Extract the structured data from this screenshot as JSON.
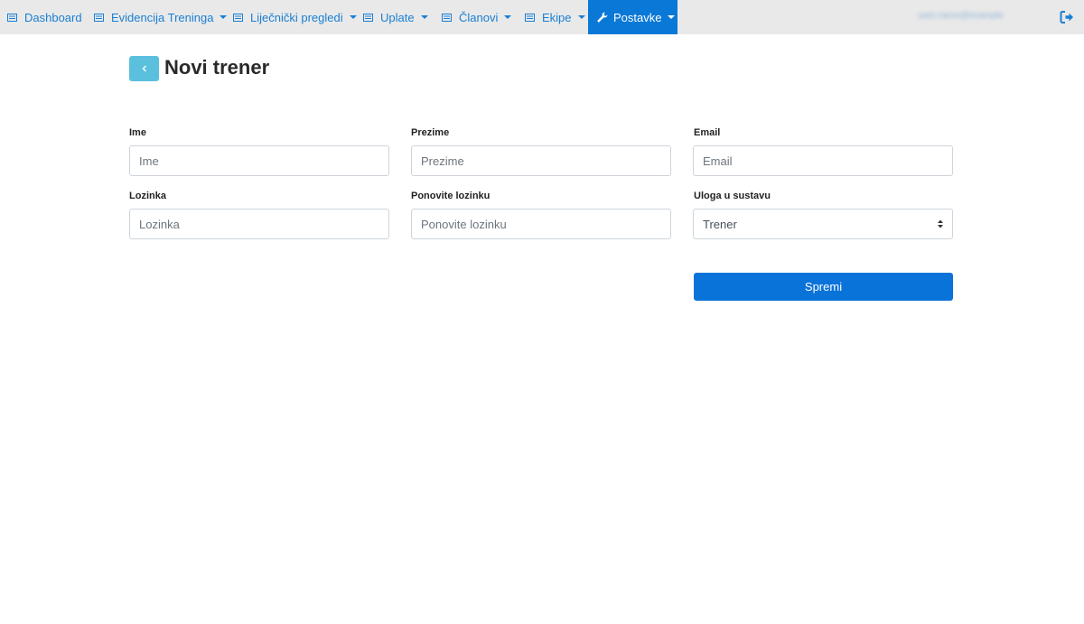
{
  "nav": {
    "items": [
      {
        "label": "Dashboard",
        "icon": "list-icon",
        "caret": false
      },
      {
        "label": "Evidencija Treninga",
        "icon": "list-icon",
        "caret": true
      },
      {
        "label": "Liječnički pregledi",
        "icon": "list-icon",
        "caret": true
      },
      {
        "label": "Uplate",
        "icon": "list-icon",
        "caret": true
      },
      {
        "label": "Članovi",
        "icon": "list-icon",
        "caret": true
      },
      {
        "label": "Ekipe",
        "icon": "list-icon",
        "caret": true
      },
      {
        "label": "Postavke",
        "icon": "wrench-icon",
        "caret": true,
        "active": true
      }
    ],
    "user_name": "user.name@example",
    "logout_icon": "sign-out-icon",
    "colors": {
      "bar": "#e9e9e9",
      "link": "#1a7fd4",
      "active": "#0a78d6"
    }
  },
  "header": {
    "back_icon": "chevron-left-icon",
    "title": "Novi trener"
  },
  "form": {
    "first_name": {
      "label": "Ime",
      "placeholder": "Ime",
      "value": ""
    },
    "last_name": {
      "label": "Prezime",
      "placeholder": "Prezime",
      "value": ""
    },
    "email": {
      "label": "Email",
      "placeholder": "Email",
      "value": ""
    },
    "password": {
      "label": "Lozinka",
      "placeholder": "Lozinka",
      "value": ""
    },
    "password_repeat": {
      "label": "Ponovite lozinku",
      "placeholder": "Ponovite lozinku",
      "value": ""
    },
    "role": {
      "label": "Uloga u sustavu",
      "selected": "Trener"
    },
    "submit_label": "Spremi"
  }
}
